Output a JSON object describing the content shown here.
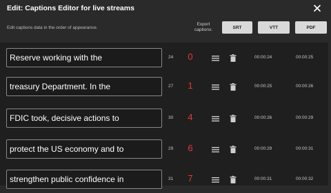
{
  "header": {
    "title": "Edit: Captions Editor for live streams",
    "subtitle": "Edit captions data in the order of appearance."
  },
  "export": {
    "label_line1": "Export",
    "label_line2": "captions:",
    "buttons": [
      "SRT",
      "VTT",
      "PDF"
    ]
  },
  "icons": {
    "close": "close-icon",
    "drag": "lines-icon",
    "delete": "trash-icon"
  },
  "colors": {
    "accent_number": "#e53935",
    "background": "#2a2a2b",
    "list_background": "#1f1f20"
  },
  "rows": [
    {
      "text": "Reserve working with the",
      "index": "24",
      "badge": "0",
      "start": "00:00:24",
      "end": "00:00:25"
    },
    {
      "text": "treasury Department. In the",
      "index": "27",
      "badge": "1",
      "start": "00:00:25",
      "end": "00:00:26"
    },
    {
      "text": "FDIC took, decisive actions to",
      "index": "30",
      "badge": "4",
      "start": "00:00:26",
      "end": "00:00:29"
    },
    {
      "text": "protect the US economy and to",
      "index": "29",
      "badge": "6",
      "start": "00:00:29",
      "end": "00:00:31"
    },
    {
      "text": "strengthen public confidence in",
      "index": "31",
      "badge": "7",
      "start": "00:00:31",
      "end": "00:00:32"
    }
  ]
}
